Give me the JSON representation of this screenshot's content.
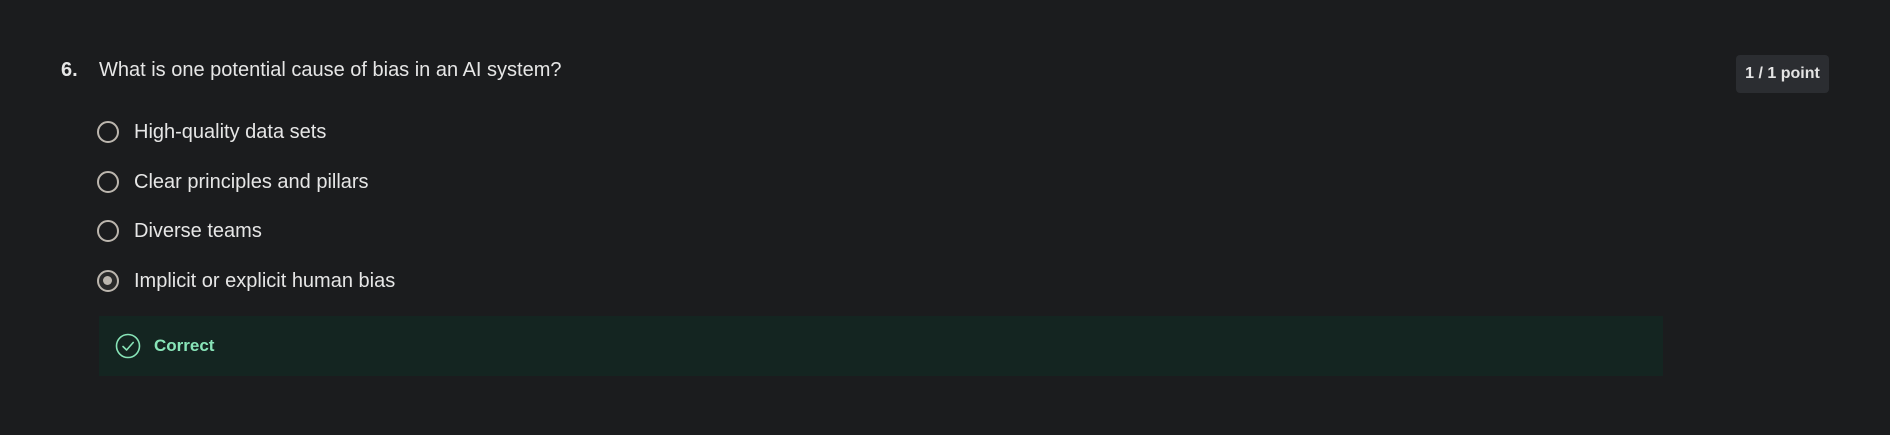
{
  "question": {
    "number": "6.",
    "text": "What is one potential cause of bias in an AI system?",
    "score": "1 / 1 point"
  },
  "options": [
    {
      "label": "High-quality data sets",
      "selected": false
    },
    {
      "label": "Clear principles and pillars",
      "selected": false
    },
    {
      "label": "Diverse teams",
      "selected": false
    },
    {
      "label": "Implicit or explicit human bias",
      "selected": true
    }
  ],
  "feedback": {
    "status": "Correct",
    "icon": "check-circle-icon"
  },
  "colors": {
    "background": "#1b1c1e",
    "feedback_background": "#142521",
    "success_accent": "#88e4b8",
    "radio_border": "#bcb6ae"
  }
}
